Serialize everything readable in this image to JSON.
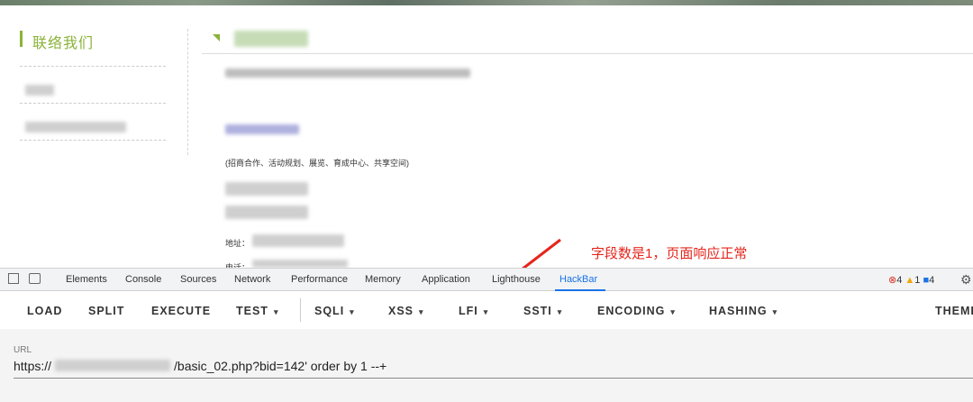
{
  "sidebar": {
    "title": "联络我们"
  },
  "content": {
    "contact_desc": "(招商合作、活动规划、展览、育成中心、共享空间)",
    "address_label": "地址：",
    "tel_label": "电话："
  },
  "annotation": {
    "text": "字段数是1，页面响应正常",
    "color": "#e5261c"
  },
  "devtools": {
    "tabs": [
      "Elements",
      "Console",
      "Sources",
      "Network",
      "Performance",
      "Memory",
      "Application",
      "Lighthouse",
      "HackBar"
    ],
    "active_tab": "HackBar",
    "status": {
      "errors": "4",
      "warnings": "1",
      "info": "4"
    }
  },
  "hackbar": {
    "buttons": {
      "load": "LOAD",
      "split": "SPLIT",
      "execute": "EXECUTE",
      "test": "TEST",
      "sqli": "SQLI",
      "xss": "XSS",
      "lfi": "LFI",
      "ssti": "SSTI",
      "encoding": "ENCODING",
      "hashing": "HASHING",
      "theme": "THEME"
    },
    "caret": "▾",
    "url_label": "URL",
    "url_prefix": "https://",
    "url_suffix": "/basic_02.php?bid=142' order by 1 --+"
  },
  "colors": {
    "accent": "#8bb33a",
    "devtools_active": "#1a73e8"
  }
}
